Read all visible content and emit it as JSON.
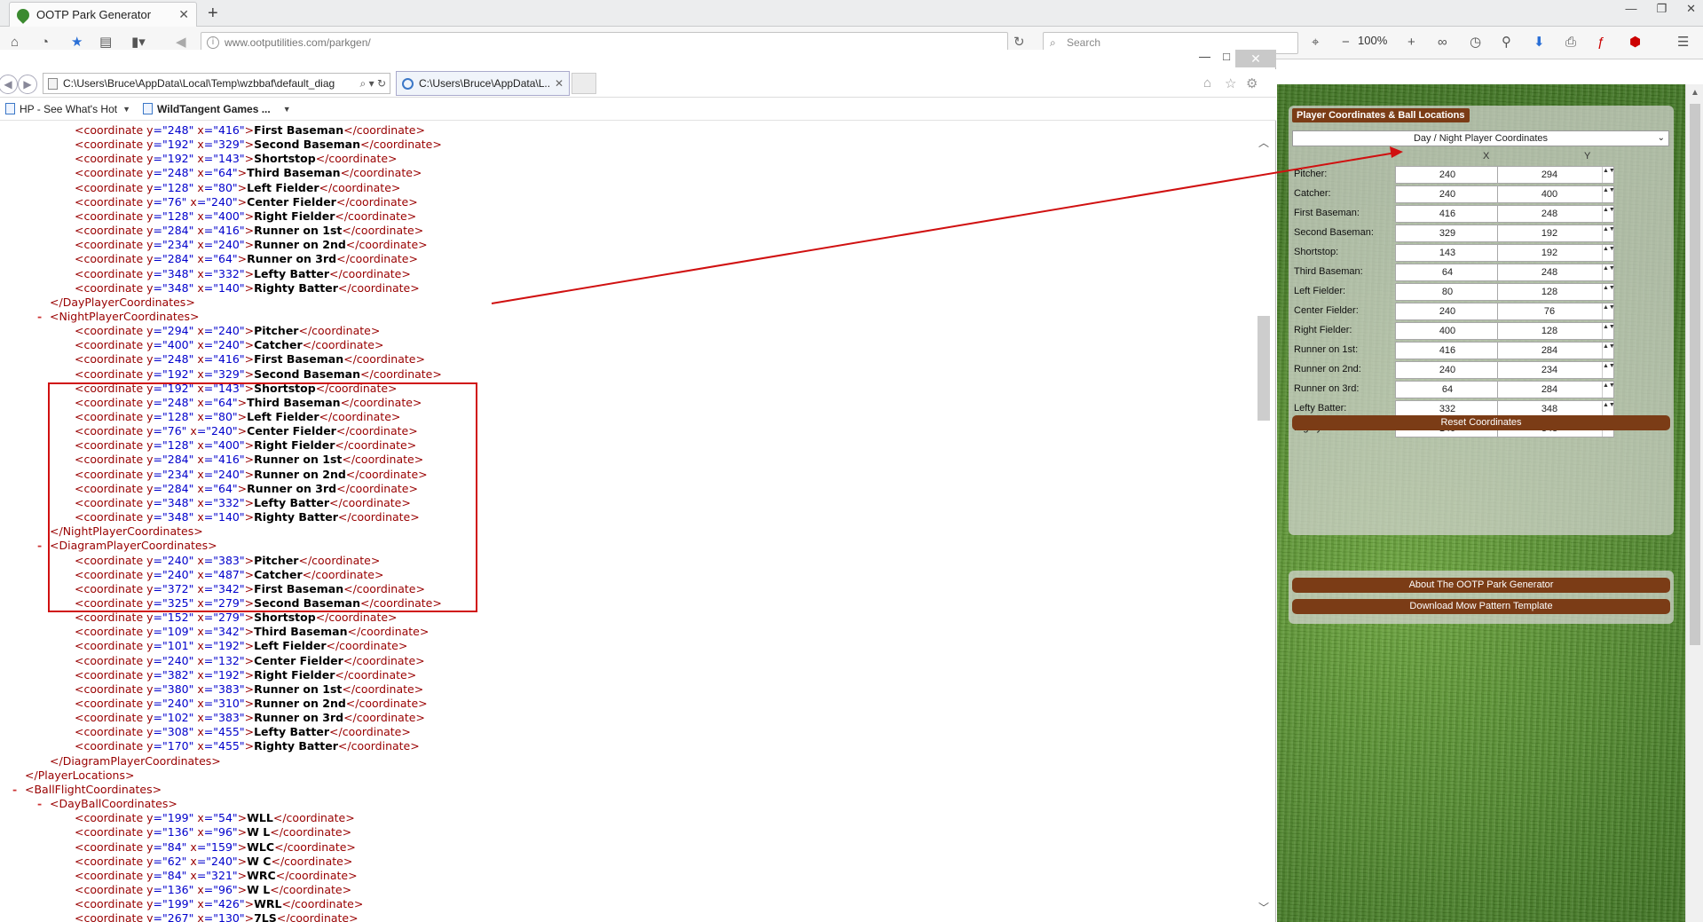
{
  "browser": {
    "tab_title": "OOTP Park Generator",
    "url": "www.ootputilities.com/parkgen/",
    "search_placeholder": "Search",
    "zoom": "100%"
  },
  "inner_window": {
    "address": "C:\\Users\\Bruce\\AppData\\Local\\Temp\\wzbbaf\\default_diag",
    "tab_label": "C:\\Users\\Bruce\\AppData\\L...",
    "favorites": [
      "HP - See What's Hot",
      "WildTangent Games ..."
    ]
  },
  "xml_lines": [
    {
      "i": 2,
      "y": "248",
      "x": "416",
      "name": "First Baseman"
    },
    {
      "i": 2,
      "y": "192",
      "x": "329",
      "name": "Second Baseman"
    },
    {
      "i": 2,
      "y": "192",
      "x": "143",
      "name": "Shortstop"
    },
    {
      "i": 2,
      "y": "248",
      "x": "64",
      "name": "Third Baseman"
    },
    {
      "i": 2,
      "y": "128",
      "x": "80",
      "name": "Left Fielder"
    },
    {
      "i": 2,
      "y": "76",
      "x": "240",
      "name": "Center Fielder"
    },
    {
      "i": 2,
      "y": "128",
      "x": "400",
      "name": "Right Fielder"
    },
    {
      "i": 2,
      "y": "284",
      "x": "416",
      "name": "Runner on 1st"
    },
    {
      "i": 2,
      "y": "234",
      "x": "240",
      "name": "Runner on 2nd"
    },
    {
      "i": 2,
      "y": "284",
      "x": "64",
      "name": "Runner on 3rd"
    },
    {
      "i": 2,
      "y": "348",
      "x": "332",
      "name": "Lefty Batter"
    },
    {
      "i": 2,
      "y": "348",
      "x": "140",
      "name": "Righty Batter"
    },
    {
      "i": 1,
      "close": "DayPlayerCoordinates"
    },
    {
      "i": 1,
      "open": "NightPlayerCoordinates",
      "minus": true
    },
    {
      "i": 2,
      "y": "294",
      "x": "240",
      "name": "Pitcher"
    },
    {
      "i": 2,
      "y": "400",
      "x": "240",
      "name": "Catcher"
    },
    {
      "i": 2,
      "y": "248",
      "x": "416",
      "name": "First Baseman"
    },
    {
      "i": 2,
      "y": "192",
      "x": "329",
      "name": "Second Baseman"
    },
    {
      "i": 2,
      "y": "192",
      "x": "143",
      "name": "Shortstop"
    },
    {
      "i": 2,
      "y": "248",
      "x": "64",
      "name": "Third Baseman"
    },
    {
      "i": 2,
      "y": "128",
      "x": "80",
      "name": "Left Fielder"
    },
    {
      "i": 2,
      "y": "76",
      "x": "240",
      "name": "Center Fielder"
    },
    {
      "i": 2,
      "y": "128",
      "x": "400",
      "name": "Right Fielder"
    },
    {
      "i": 2,
      "y": "284",
      "x": "416",
      "name": "Runner on 1st"
    },
    {
      "i": 2,
      "y": "234",
      "x": "240",
      "name": "Runner on 2nd"
    },
    {
      "i": 2,
      "y": "284",
      "x": "64",
      "name": "Runner on 3rd"
    },
    {
      "i": 2,
      "y": "348",
      "x": "332",
      "name": "Lefty Batter"
    },
    {
      "i": 2,
      "y": "348",
      "x": "140",
      "name": "Righty Batter"
    },
    {
      "i": 1,
      "close": "NightPlayerCoordinates"
    },
    {
      "i": 1,
      "open": "DiagramPlayerCoordinates",
      "minus": true
    },
    {
      "i": 2,
      "y": "240",
      "x": "383",
      "name": "Pitcher"
    },
    {
      "i": 2,
      "y": "240",
      "x": "487",
      "name": "Catcher"
    },
    {
      "i": 2,
      "y": "372",
      "x": "342",
      "name": "First Baseman"
    },
    {
      "i": 2,
      "y": "325",
      "x": "279",
      "name": "Second Baseman"
    },
    {
      "i": 2,
      "y": "152",
      "x": "279",
      "name": "Shortstop"
    },
    {
      "i": 2,
      "y": "109",
      "x": "342",
      "name": "Third Baseman"
    },
    {
      "i": 2,
      "y": "101",
      "x": "192",
      "name": "Left Fielder"
    },
    {
      "i": 2,
      "y": "240",
      "x": "132",
      "name": "Center Fielder"
    },
    {
      "i": 2,
      "y": "382",
      "x": "192",
      "name": "Right Fielder"
    },
    {
      "i": 2,
      "y": "380",
      "x": "383",
      "name": "Runner on 1st"
    },
    {
      "i": 2,
      "y": "240",
      "x": "310",
      "name": "Runner on 2nd"
    },
    {
      "i": 2,
      "y": "102",
      "x": "383",
      "name": "Runner on 3rd"
    },
    {
      "i": 2,
      "y": "308",
      "x": "455",
      "name": "Lefty Batter"
    },
    {
      "i": 2,
      "y": "170",
      "x": "455",
      "name": "Righty Batter"
    },
    {
      "i": 1,
      "close": "DiagramPlayerCoordinates"
    },
    {
      "i": 0,
      "close": "PlayerLocations"
    },
    {
      "i": 0,
      "open": "BallFlightCoordinates",
      "minus": true
    },
    {
      "i": 1,
      "open": "DayBallCoordinates",
      "minus": true
    },
    {
      "i": 2,
      "y": "199",
      "x": "54",
      "name": "WLL"
    },
    {
      "i": 2,
      "y": "136",
      "x": "96",
      "name": "W L"
    },
    {
      "i": 2,
      "y": "84",
      "x": "159",
      "name": "WLC"
    },
    {
      "i": 2,
      "y": "62",
      "x": "240",
      "name": "W C"
    },
    {
      "i": 2,
      "y": "84",
      "x": "321",
      "name": "WRC"
    },
    {
      "i": 2,
      "y": "136",
      "x": "96",
      "name": "W L"
    },
    {
      "i": 2,
      "y": "199",
      "x": "426",
      "name": "WRL"
    },
    {
      "i": 2,
      "y": "267",
      "x": "130",
      "name": "7LS"
    }
  ],
  "panel": {
    "title": "Player Coordinates & Ball Locations",
    "mode": "Day / Night Player Coordinates",
    "col_x": "X",
    "col_y": "Y",
    "rows": [
      {
        "label": "Pitcher:",
        "x": "240",
        "y": "294"
      },
      {
        "label": "Catcher:",
        "x": "240",
        "y": "400"
      },
      {
        "label": "First Baseman:",
        "x": "416",
        "y": "248"
      },
      {
        "label": "Second Baseman:",
        "x": "329",
        "y": "192"
      },
      {
        "label": "Shortstop:",
        "x": "143",
        "y": "192"
      },
      {
        "label": "Third Baseman:",
        "x": "64",
        "y": "248"
      },
      {
        "label": "Left Fielder:",
        "x": "80",
        "y": "128"
      },
      {
        "label": "Center Fielder:",
        "x": "240",
        "y": "76"
      },
      {
        "label": "Right Fielder:",
        "x": "400",
        "y": "128"
      },
      {
        "label": "Runner on 1st:",
        "x": "416",
        "y": "284"
      },
      {
        "label": "Runner on 2nd:",
        "x": "240",
        "y": "234"
      },
      {
        "label": "Runner on 3rd:",
        "x": "64",
        "y": "284"
      },
      {
        "label": "Lefty Batter:",
        "x": "332",
        "y": "348"
      },
      {
        "label": "Righty Batter:",
        "x": "140",
        "y": "348"
      }
    ],
    "reset_label": "Reset Coordinates",
    "about_label": "About The OOTP Park Generator",
    "download_label": "Download Mow Pattern Template"
  },
  "colors": {
    "accent_brown": "#7b3c16",
    "xml_tag": "#990000",
    "xml_value": "#0000cc",
    "highlight": "#d01010"
  }
}
